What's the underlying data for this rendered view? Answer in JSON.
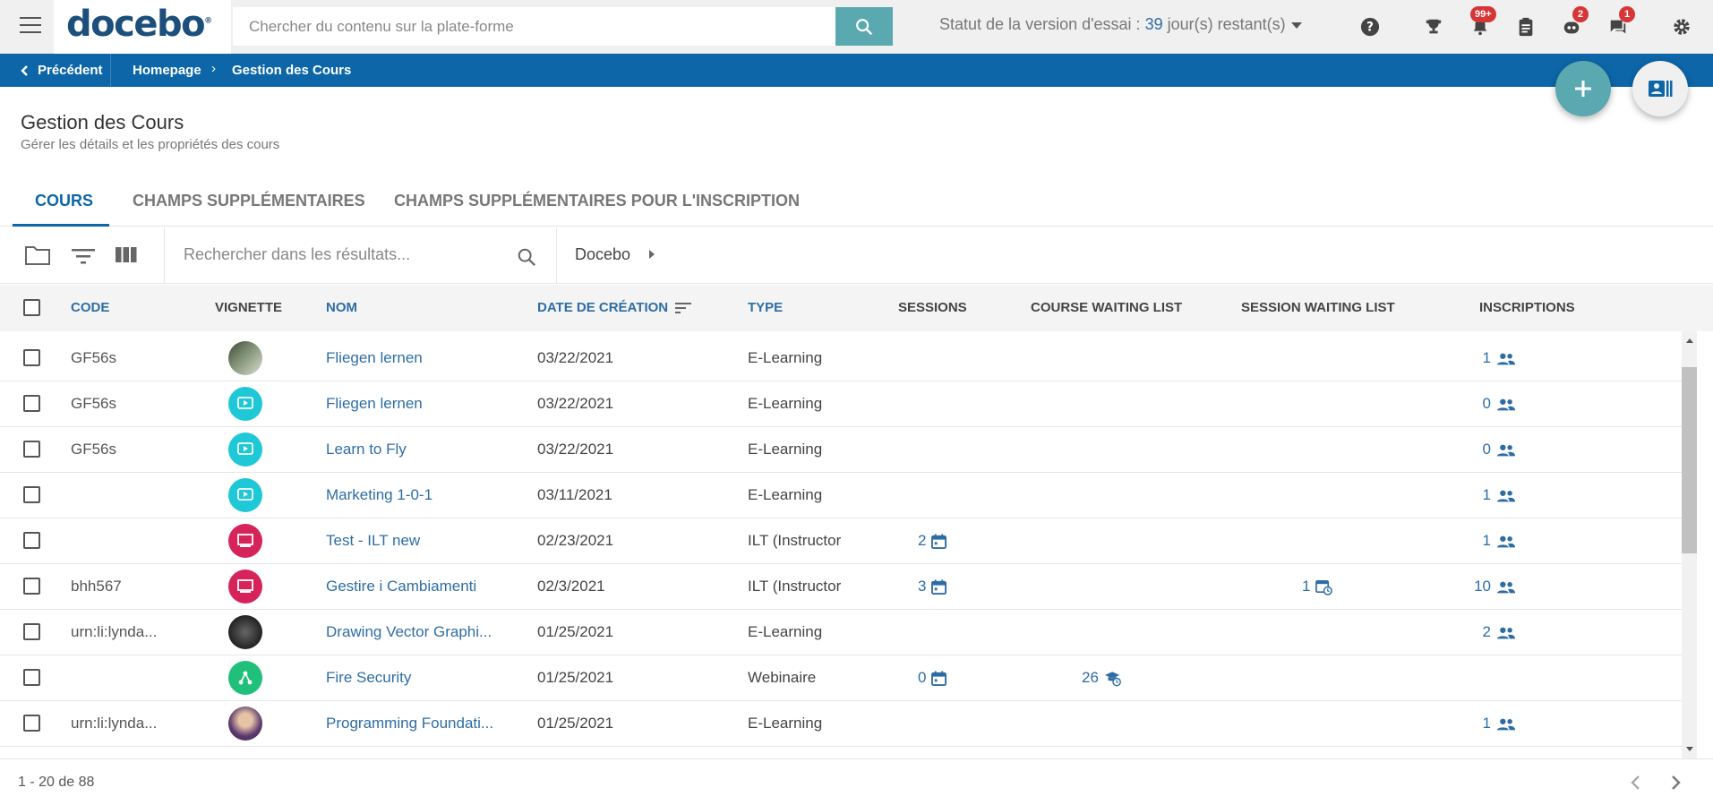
{
  "header": {
    "logo": "docebo",
    "search_placeholder": "Chercher du contenu sur la plate-forme",
    "trial_prefix": "Statut de la version d'essai : ",
    "trial_days": "39",
    "trial_suffix": " jour(s) restant(s)",
    "badges": {
      "notifications": "99+",
      "bot": "2",
      "messages": "1"
    },
    "accent_color": "#5aa9b0"
  },
  "breadcrumb": {
    "back_label": "Précédent",
    "home": "Homepage",
    "current": "Gestion des Cours"
  },
  "page": {
    "title": "Gestion des Cours",
    "subtitle": "Gérer les détails et les propriétés des cours"
  },
  "tabs": [
    {
      "label": "COURS",
      "active": true
    },
    {
      "label": "CHAMPS SUPPLÉMENTAIRES",
      "active": false
    },
    {
      "label": "CHAMPS SUPPLÉMENTAIRES POUR L'INSCRIPTION",
      "active": false
    }
  ],
  "toolbar": {
    "search_placeholder": "Rechercher dans les résultats...",
    "folder_crumb": "Docebo"
  },
  "table": {
    "columns": {
      "code": "CODE",
      "thumbnail": "VIGNETTE",
      "name": "NOM",
      "created": "DATE DE CRÉATION",
      "type": "TYPE",
      "sessions": "SESSIONS",
      "course_waiting": "COURSE WAITING LIST",
      "session_waiting": "SESSION WAITING LIST",
      "enrollments": "INSCRIPTIONS"
    },
    "rows": [
      {
        "code": "GF56s",
        "thumb": "photo-landscape",
        "name": "Fliegen lernen",
        "date": "03/22/2021",
        "type": "E-Learning",
        "sessions": "",
        "course_waiting": "",
        "session_waiting": "",
        "enrollments": "1"
      },
      {
        "code": "GF56s",
        "thumb": "elearning",
        "name": "Fliegen lernen",
        "date": "03/22/2021",
        "type": "E-Learning",
        "sessions": "",
        "course_waiting": "",
        "session_waiting": "",
        "enrollments": "0"
      },
      {
        "code": "GF56s",
        "thumb": "elearning",
        "name": "Learn to Fly",
        "date": "03/22/2021",
        "type": "E-Learning",
        "sessions": "",
        "course_waiting": "",
        "session_waiting": "",
        "enrollments": "0"
      },
      {
        "code": "",
        "thumb": "elearning",
        "name": "Marketing 1-0-1",
        "date": "03/11/2021",
        "type": "E-Learning",
        "sessions": "",
        "course_waiting": "",
        "session_waiting": "",
        "enrollments": "1"
      },
      {
        "code": "",
        "thumb": "ilt",
        "name": "Test - ILT new",
        "date": "02/23/2021",
        "type": "ILT (Instructor",
        "sessions": "2",
        "course_waiting": "",
        "session_waiting": "",
        "enrollments": "1"
      },
      {
        "code": "bhh567",
        "thumb": "ilt",
        "name": "Gestire i Cambiamenti",
        "date": "02/3/2021",
        "type": "ILT (Instructor",
        "sessions": "3",
        "course_waiting": "",
        "session_waiting": "1",
        "enrollments": "10"
      },
      {
        "code": "urn:li:lynda...",
        "thumb": "photo-dark",
        "name": "Drawing Vector Graphi...",
        "date": "01/25/2021",
        "type": "E-Learning",
        "sessions": "",
        "course_waiting": "",
        "session_waiting": "",
        "enrollments": "2"
      },
      {
        "code": "",
        "thumb": "webinar",
        "name": "Fire Security",
        "date": "01/25/2021",
        "type": "Webinaire",
        "sessions": "0",
        "course_waiting": "26",
        "session_waiting": "",
        "enrollments": ""
      },
      {
        "code": "urn:li:lynda...",
        "thumb": "photo-person",
        "name": "Programming Foundati...",
        "date": "01/25/2021",
        "type": "E-Learning",
        "sessions": "",
        "course_waiting": "",
        "session_waiting": "",
        "enrollments": "1"
      }
    ]
  },
  "footer": {
    "page_count": "1 - 20 de 88"
  }
}
